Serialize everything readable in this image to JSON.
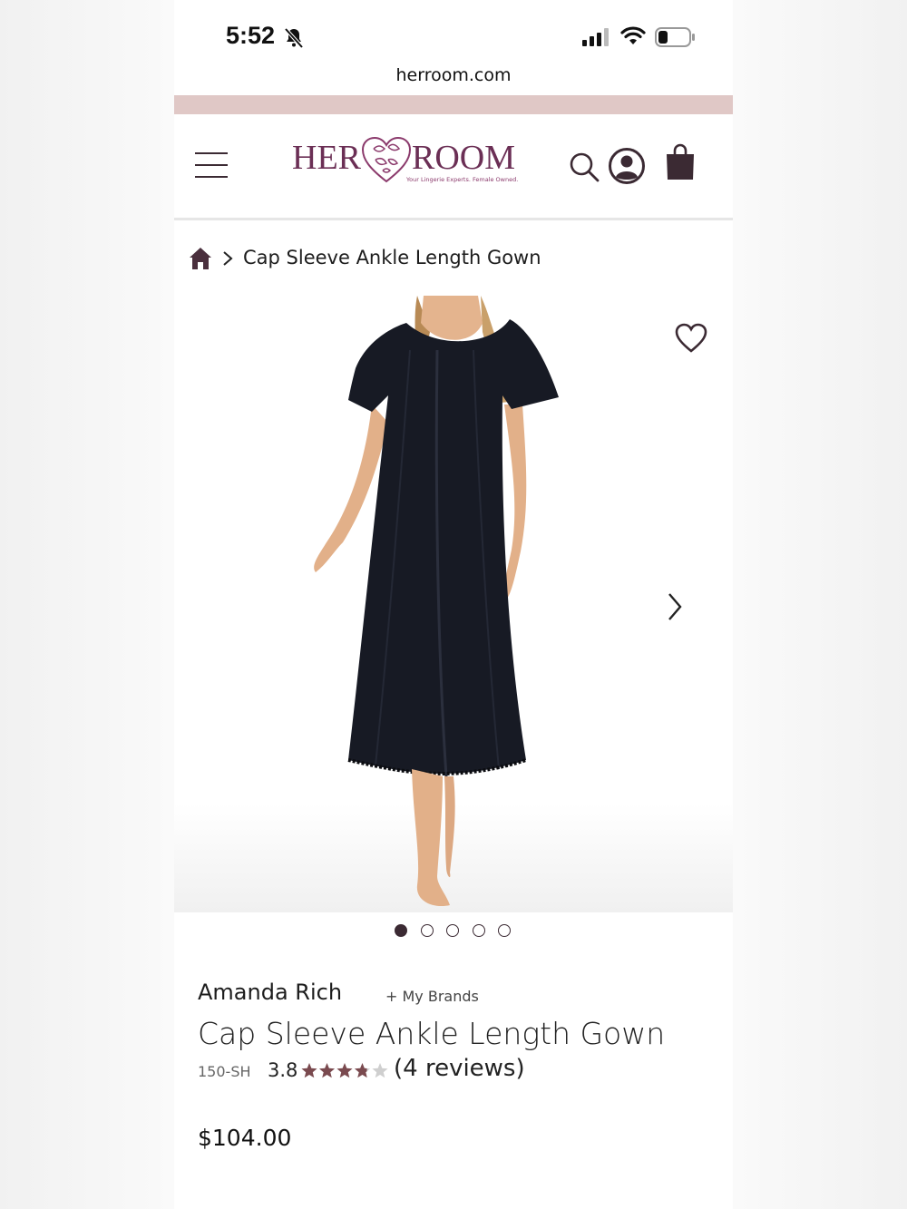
{
  "status_bar": {
    "time": "5:52"
  },
  "browser": {
    "url": "herroom.com"
  },
  "header": {
    "logo_left": "HER",
    "logo_right": "ROOM",
    "logo_tagline": "Your Lingerie Experts. Female Owned."
  },
  "breadcrumb": {
    "current": "Cap Sleeve Ankle Length Gown"
  },
  "gallery": {
    "image_count": 5,
    "active_index": 0
  },
  "product": {
    "brand": "Amanda Rich",
    "my_brands_label": "+ My Brands",
    "title": "Cap Sleeve Ankle Length Gown",
    "sku": "150-SH",
    "rating": "3.8",
    "rating_value": 3.8,
    "rating_max": 5,
    "reviews": "(4 reviews)",
    "price": "$104.00"
  },
  "colors": {
    "brand_plum": "#6b2f55",
    "icon_dark": "#3b2a33",
    "promo_bar": "#e0c8c6",
    "star": "#7a4a4f"
  }
}
